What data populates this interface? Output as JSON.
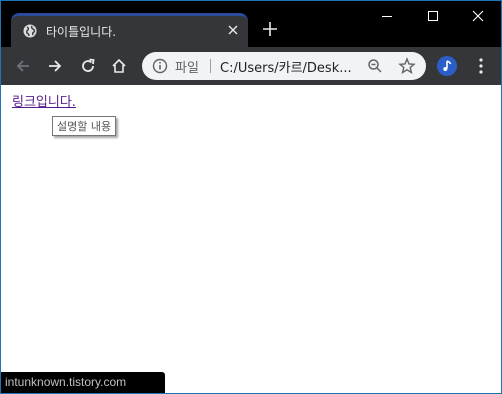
{
  "tab": {
    "title": "타이틀입니다.",
    "icon": "globe-icon"
  },
  "window_controls": [
    "minimize-icon",
    "maximize-icon",
    "close-icon"
  ],
  "toolbar": {
    "nav_icons": [
      "back-icon",
      "forward-icon",
      "reload-icon",
      "home-icon"
    ],
    "address": {
      "chip_label": "파일",
      "url": "C:/Users/카르/Desk..."
    },
    "profile_color": "#2b5ec7"
  },
  "page": {
    "link_text": "링크입니다.",
    "tooltip_text": "설명할 내용"
  },
  "status_bar": {
    "text": "intunknown.tistory.com"
  },
  "colors": {
    "titlebar": "#000000",
    "tab": "#35363a",
    "link_visited": "#551a8b",
    "window_border": "#1b76b6"
  }
}
